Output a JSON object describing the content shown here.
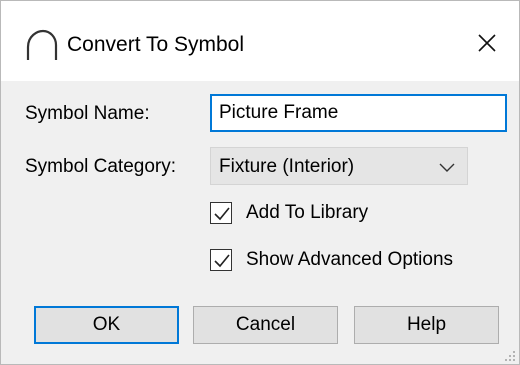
{
  "window": {
    "title": "Convert To Symbol",
    "icon": "arc-icon",
    "close_icon": "close-icon"
  },
  "form": {
    "name_label": "Symbol Name:",
    "name_value": "Picture Frame",
    "category_label": "Symbol Category:",
    "category_value": "Fixture (Interior)"
  },
  "options": {
    "add_to_library": {
      "label": "Add To Library",
      "checked": true
    },
    "show_advanced": {
      "label": "Show Advanced Options",
      "checked": true
    }
  },
  "buttons": {
    "ok": "OK",
    "cancel": "Cancel",
    "help": "Help"
  },
  "colors": {
    "accent": "#0078d7",
    "dialog_bg": "#f0f0f0",
    "titlebar_bg": "#ffffff",
    "button_bg": "#e1e1e1"
  }
}
